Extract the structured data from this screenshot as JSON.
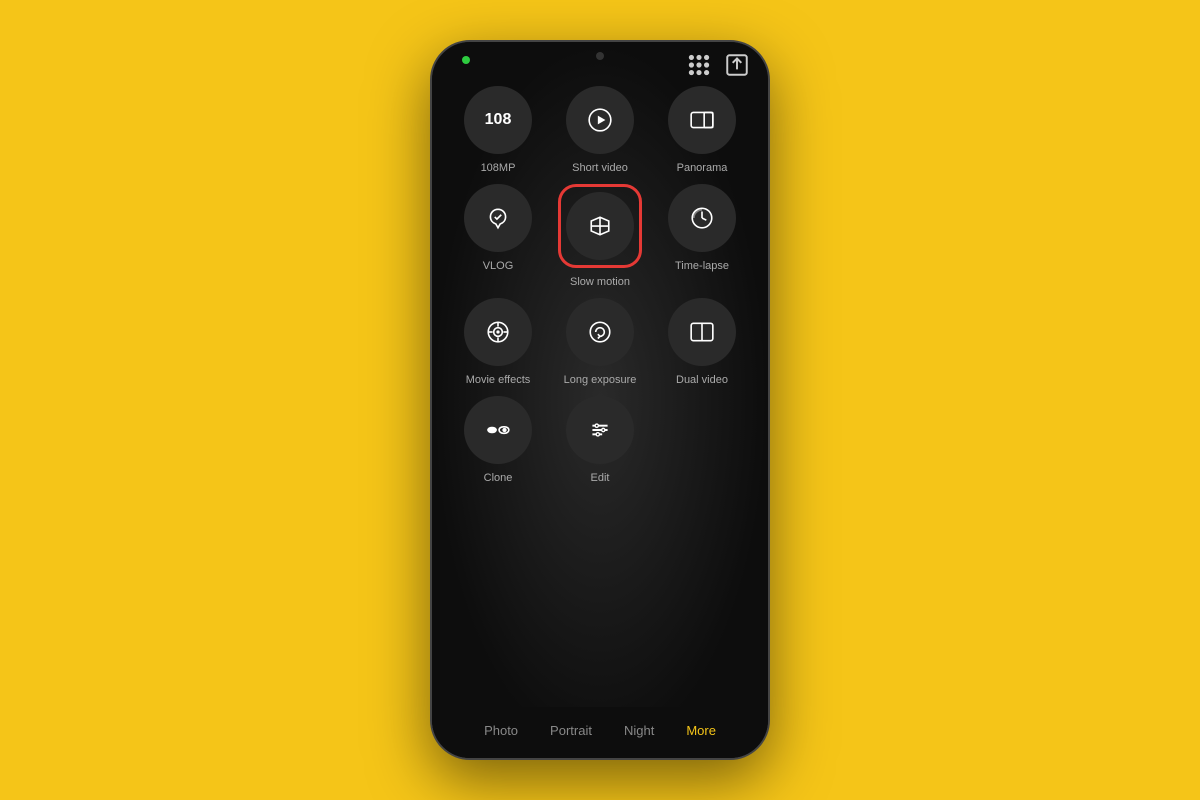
{
  "background_color": "#F5C518",
  "phone": {
    "top_icons": {
      "grid_icon": "⊞",
      "share_icon": "↗"
    },
    "camera_indicator": "●",
    "modes": [
      {
        "id": "108mp",
        "label": "108MP",
        "symbol": "108",
        "type": "text",
        "highlighted": false
      },
      {
        "id": "short-video",
        "label": "Short video",
        "symbol": "▶",
        "type": "play",
        "highlighted": false
      },
      {
        "id": "panorama",
        "label": "Panorama",
        "symbol": "□→",
        "type": "panorama",
        "highlighted": false
      },
      {
        "id": "vlog",
        "label": "VLOG",
        "symbol": "♥",
        "type": "vlog",
        "highlighted": false
      },
      {
        "id": "slow-motion",
        "label": "Slow motion",
        "symbol": "⋈",
        "type": "slow",
        "highlighted": true
      },
      {
        "id": "time-lapse",
        "label": "Time-lapse",
        "symbol": "◑",
        "type": "timelapse",
        "highlighted": false
      },
      {
        "id": "movie-effects",
        "label": "Movie effects",
        "symbol": "⊛",
        "type": "movie",
        "highlighted": false
      },
      {
        "id": "long-exposure",
        "label": "Long exposure",
        "symbol": "↺",
        "type": "longexp",
        "highlighted": false
      },
      {
        "id": "dual-video",
        "label": "Dual video",
        "symbol": "▣",
        "type": "dual",
        "highlighted": false
      },
      {
        "id": "clone",
        "label": "Clone",
        "symbol": "◑◑",
        "type": "clone",
        "highlighted": false
      },
      {
        "id": "edit",
        "label": "Edit",
        "symbol": "≡",
        "type": "edit",
        "highlighted": false
      }
    ],
    "bottom_nav": [
      {
        "id": "photo",
        "label": "Photo",
        "active": false
      },
      {
        "id": "portrait",
        "label": "Portrait",
        "active": false
      },
      {
        "id": "night",
        "label": "Night",
        "active": false
      },
      {
        "id": "more",
        "label": "More",
        "active": true
      }
    ]
  }
}
